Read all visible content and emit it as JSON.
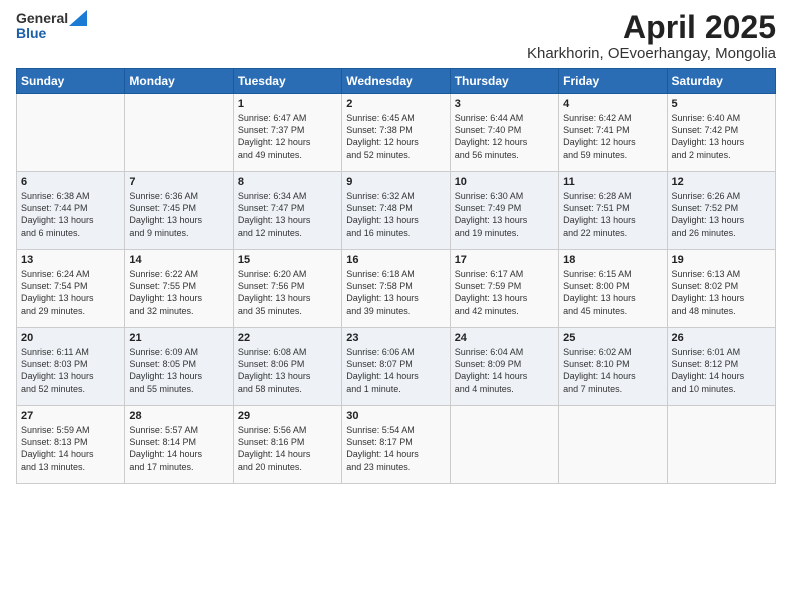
{
  "header": {
    "logo_general": "General",
    "logo_blue": "Blue",
    "month_year": "April 2025",
    "location": "Kharkhorin, OEvoerhangay, Mongolia"
  },
  "days_of_week": [
    "Sunday",
    "Monday",
    "Tuesday",
    "Wednesday",
    "Thursday",
    "Friday",
    "Saturday"
  ],
  "weeks": [
    [
      {
        "day": "",
        "info": ""
      },
      {
        "day": "",
        "info": ""
      },
      {
        "day": "1",
        "info": "Sunrise: 6:47 AM\nSunset: 7:37 PM\nDaylight: 12 hours\nand 49 minutes."
      },
      {
        "day": "2",
        "info": "Sunrise: 6:45 AM\nSunset: 7:38 PM\nDaylight: 12 hours\nand 52 minutes."
      },
      {
        "day": "3",
        "info": "Sunrise: 6:44 AM\nSunset: 7:40 PM\nDaylight: 12 hours\nand 56 minutes."
      },
      {
        "day": "4",
        "info": "Sunrise: 6:42 AM\nSunset: 7:41 PM\nDaylight: 12 hours\nand 59 minutes."
      },
      {
        "day": "5",
        "info": "Sunrise: 6:40 AM\nSunset: 7:42 PM\nDaylight: 13 hours\nand 2 minutes."
      }
    ],
    [
      {
        "day": "6",
        "info": "Sunrise: 6:38 AM\nSunset: 7:44 PM\nDaylight: 13 hours\nand 6 minutes."
      },
      {
        "day": "7",
        "info": "Sunrise: 6:36 AM\nSunset: 7:45 PM\nDaylight: 13 hours\nand 9 minutes."
      },
      {
        "day": "8",
        "info": "Sunrise: 6:34 AM\nSunset: 7:47 PM\nDaylight: 13 hours\nand 12 minutes."
      },
      {
        "day": "9",
        "info": "Sunrise: 6:32 AM\nSunset: 7:48 PM\nDaylight: 13 hours\nand 16 minutes."
      },
      {
        "day": "10",
        "info": "Sunrise: 6:30 AM\nSunset: 7:49 PM\nDaylight: 13 hours\nand 19 minutes."
      },
      {
        "day": "11",
        "info": "Sunrise: 6:28 AM\nSunset: 7:51 PM\nDaylight: 13 hours\nand 22 minutes."
      },
      {
        "day": "12",
        "info": "Sunrise: 6:26 AM\nSunset: 7:52 PM\nDaylight: 13 hours\nand 26 minutes."
      }
    ],
    [
      {
        "day": "13",
        "info": "Sunrise: 6:24 AM\nSunset: 7:54 PM\nDaylight: 13 hours\nand 29 minutes."
      },
      {
        "day": "14",
        "info": "Sunrise: 6:22 AM\nSunset: 7:55 PM\nDaylight: 13 hours\nand 32 minutes."
      },
      {
        "day": "15",
        "info": "Sunrise: 6:20 AM\nSunset: 7:56 PM\nDaylight: 13 hours\nand 35 minutes."
      },
      {
        "day": "16",
        "info": "Sunrise: 6:18 AM\nSunset: 7:58 PM\nDaylight: 13 hours\nand 39 minutes."
      },
      {
        "day": "17",
        "info": "Sunrise: 6:17 AM\nSunset: 7:59 PM\nDaylight: 13 hours\nand 42 minutes."
      },
      {
        "day": "18",
        "info": "Sunrise: 6:15 AM\nSunset: 8:00 PM\nDaylight: 13 hours\nand 45 minutes."
      },
      {
        "day": "19",
        "info": "Sunrise: 6:13 AM\nSunset: 8:02 PM\nDaylight: 13 hours\nand 48 minutes."
      }
    ],
    [
      {
        "day": "20",
        "info": "Sunrise: 6:11 AM\nSunset: 8:03 PM\nDaylight: 13 hours\nand 52 minutes."
      },
      {
        "day": "21",
        "info": "Sunrise: 6:09 AM\nSunset: 8:05 PM\nDaylight: 13 hours\nand 55 minutes."
      },
      {
        "day": "22",
        "info": "Sunrise: 6:08 AM\nSunset: 8:06 PM\nDaylight: 13 hours\nand 58 minutes."
      },
      {
        "day": "23",
        "info": "Sunrise: 6:06 AM\nSunset: 8:07 PM\nDaylight: 14 hours\nand 1 minute."
      },
      {
        "day": "24",
        "info": "Sunrise: 6:04 AM\nSunset: 8:09 PM\nDaylight: 14 hours\nand 4 minutes."
      },
      {
        "day": "25",
        "info": "Sunrise: 6:02 AM\nSunset: 8:10 PM\nDaylight: 14 hours\nand 7 minutes."
      },
      {
        "day": "26",
        "info": "Sunrise: 6:01 AM\nSunset: 8:12 PM\nDaylight: 14 hours\nand 10 minutes."
      }
    ],
    [
      {
        "day": "27",
        "info": "Sunrise: 5:59 AM\nSunset: 8:13 PM\nDaylight: 14 hours\nand 13 minutes."
      },
      {
        "day": "28",
        "info": "Sunrise: 5:57 AM\nSunset: 8:14 PM\nDaylight: 14 hours\nand 17 minutes."
      },
      {
        "day": "29",
        "info": "Sunrise: 5:56 AM\nSunset: 8:16 PM\nDaylight: 14 hours\nand 20 minutes."
      },
      {
        "day": "30",
        "info": "Sunrise: 5:54 AM\nSunset: 8:17 PM\nDaylight: 14 hours\nand 23 minutes."
      },
      {
        "day": "",
        "info": ""
      },
      {
        "day": "",
        "info": ""
      },
      {
        "day": "",
        "info": ""
      }
    ]
  ]
}
